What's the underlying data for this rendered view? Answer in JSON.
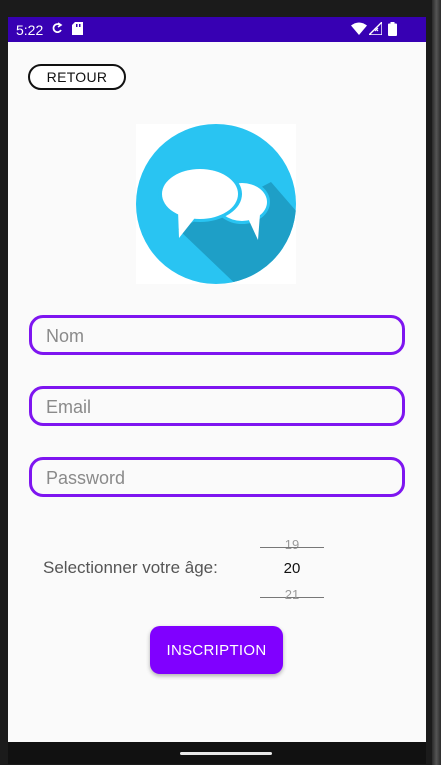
{
  "status_bar": {
    "time": "5:22",
    "icons": [
      "sync-icon",
      "sd-card-icon",
      "wifi-icon",
      "signal-icon",
      "battery-icon"
    ],
    "background": "#3700b3"
  },
  "header": {
    "back_label": "RETOUR"
  },
  "logo": {
    "icon": "chat-bubbles-icon",
    "circle_color": "#29c4f2",
    "shadow_color": "#1e9fc7"
  },
  "form": {
    "name_placeholder": "Nom",
    "email_placeholder": "Email",
    "password_placeholder": "Password",
    "border_color": "#7e15f0"
  },
  "age": {
    "label": "Selectionner votre âge:",
    "previous": "19",
    "selected": "20",
    "next": "21"
  },
  "submit": {
    "label": "INSCRIPTION",
    "color": "#8000ff"
  }
}
